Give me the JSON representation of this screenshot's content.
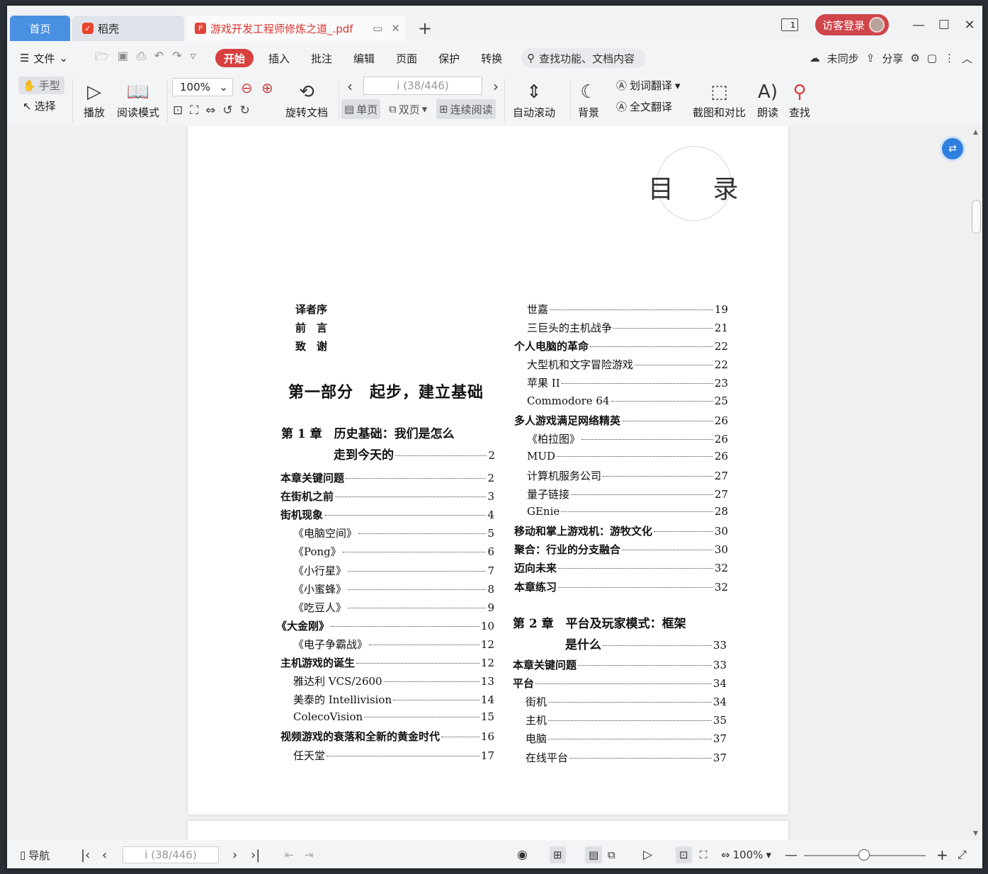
{
  "tabs": {
    "home": "首页",
    "daoke": "稻壳",
    "document": "游戏开发工程师修炼之道_.pdf"
  },
  "window": {
    "login": "访客登录",
    "page_toggle": "1"
  },
  "menu": {
    "file": "文件",
    "items": [
      "开始",
      "插入",
      "批注",
      "编辑",
      "页面",
      "保护",
      "转换"
    ],
    "search_placeholder": "查找功能、文档内容",
    "sync": "未同步",
    "share": "分享"
  },
  "ribbon": {
    "hand": "手型",
    "select": "选择",
    "play": "播放",
    "read_mode": "阅读模式",
    "zoom": "100%",
    "rotate": "旋转文档",
    "page_value": "i (38/446)",
    "single": "单页",
    "double": "双页",
    "continuous": "连续阅读",
    "auto_scroll": "自动滚动",
    "background": "背景",
    "word_translate": "划词翻译",
    "full_translate": "全文翻译",
    "screenshot": "截图和对比",
    "read_aloud": "朗读",
    "find": "查找"
  },
  "document": {
    "toc_title": "目 录",
    "front": [
      "译者序",
      "前　言",
      "致　谢"
    ],
    "part1": "第一部分　起步，建立基础",
    "chapter1": {
      "line1": "第 1 章　历史基础：我们是怎么",
      "line2": "走到今天的",
      "page": "2"
    },
    "left_entries": [
      {
        "t": "本章关键问题",
        "n": "2",
        "bold": true,
        "indent": 0
      },
      {
        "t": "在街机之前",
        "n": "3",
        "bold": true,
        "indent": 0
      },
      {
        "t": "街机现象",
        "n": "4",
        "bold": true,
        "indent": 0
      },
      {
        "t": "《电脑空间》",
        "n": "5",
        "bold": false,
        "indent": 1
      },
      {
        "t": "《Pong》",
        "n": "6",
        "bold": false,
        "indent": 1
      },
      {
        "t": "《小行星》",
        "n": "7",
        "bold": false,
        "indent": 1
      },
      {
        "t": "《小蜜蜂》",
        "n": "8",
        "bold": false,
        "indent": 1
      },
      {
        "t": "《吃豆人》",
        "n": "9",
        "bold": false,
        "indent": 1
      },
      {
        "t": "《大金刚》",
        "n": "10",
        "bold": true,
        "indent": -1
      },
      {
        "t": "《电子争霸战》",
        "n": "12",
        "bold": false,
        "indent": 1
      },
      {
        "t": "主机游戏的诞生",
        "n": "12",
        "bold": true,
        "indent": 0
      },
      {
        "t": "雅达利 VCS/2600",
        "n": "13",
        "bold": false,
        "indent": 1
      },
      {
        "t": "美泰的 Intellivision",
        "n": "14",
        "bold": false,
        "indent": 1
      },
      {
        "t": "ColecoVision",
        "n": "15",
        "bold": false,
        "indent": 1
      },
      {
        "t": "视频游戏的衰落和全新的黄金时代",
        "n": "16",
        "bold": true,
        "indent": 0
      },
      {
        "t": "任天堂",
        "n": "17",
        "bold": false,
        "indent": 1
      }
    ],
    "right_entries": [
      {
        "t": "世嘉",
        "n": "19",
        "bold": false,
        "indent": 1
      },
      {
        "t": "三巨头的主机战争",
        "n": "21",
        "bold": false,
        "indent": 1
      },
      {
        "t": "个人电脑的革命",
        "n": "22",
        "bold": true,
        "indent": 0
      },
      {
        "t": "大型机和文字冒险游戏",
        "n": "22",
        "bold": false,
        "indent": 1
      },
      {
        "t": "苹果 II",
        "n": "23",
        "bold": false,
        "indent": 1
      },
      {
        "t": "Commodore 64",
        "n": "25",
        "bold": false,
        "indent": 1
      },
      {
        "t": "多人游戏满足网络精英",
        "n": "26",
        "bold": true,
        "indent": 0
      },
      {
        "t": "《柏拉图》",
        "n": "26",
        "bold": false,
        "indent": 1
      },
      {
        "t": "MUD",
        "n": "26",
        "bold": false,
        "indent": 1
      },
      {
        "t": "计算机服务公司",
        "n": "27",
        "bold": false,
        "indent": 1
      },
      {
        "t": "量子链接",
        "n": "27",
        "bold": false,
        "indent": 1
      },
      {
        "t": "GEnie",
        "n": "28",
        "bold": false,
        "indent": 1
      },
      {
        "t": "移动和掌上游戏机：游牧文化",
        "n": "30",
        "bold": true,
        "indent": 0
      },
      {
        "t": "聚合：行业的分支融合",
        "n": "30",
        "bold": true,
        "indent": 0
      },
      {
        "t": "迈向未来",
        "n": "32",
        "bold": true,
        "indent": 0
      },
      {
        "t": "本章练习",
        "n": "32",
        "bold": true,
        "indent": 0
      }
    ],
    "chapter2": {
      "line1": "第 2 章　平台及玩家模式：框架",
      "line2": "是什么",
      "page": "33"
    },
    "right_entries2": [
      {
        "t": "本章关键问题",
        "n": "33",
        "bold": true,
        "indent": 0
      },
      {
        "t": "平台",
        "n": "34",
        "bold": true,
        "indent": 0
      },
      {
        "t": "街机",
        "n": "34",
        "bold": false,
        "indent": 1
      },
      {
        "t": "主机",
        "n": "35",
        "bold": false,
        "indent": 1
      },
      {
        "t": "电脑",
        "n": "37",
        "bold": false,
        "indent": 1
      },
      {
        "t": "在线平台",
        "n": "37",
        "bold": false,
        "indent": 1
      }
    ]
  },
  "statusbar": {
    "nav": "导航",
    "page_value": "i (38/446)",
    "zoom": "100%"
  }
}
